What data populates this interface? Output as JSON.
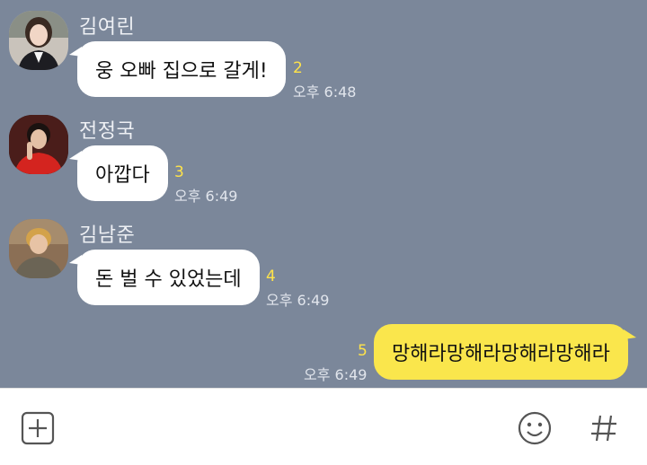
{
  "messages": [
    {
      "sender": "김여린",
      "text": "웅 오빠 집으로 갈게!",
      "unread": "2",
      "time": "오후 6:48",
      "avatar": "profile-photo"
    },
    {
      "sender": "전정국",
      "text": "아깝다",
      "unread": "3",
      "time": "오후 6:49",
      "avatar": "profile-photo"
    },
    {
      "sender": "김남준",
      "text": "돈 벌 수 있었는데",
      "unread": "4",
      "time": "오후 6:49",
      "avatar": "profile-photo"
    }
  ],
  "my_message": {
    "text": "망해라망해라망해라망해라",
    "unread": "5",
    "time": "오후 6:49"
  },
  "input_bar": {
    "left_icon": "plus-icon",
    "emoji_icon": "emoticon-icon",
    "hash_icon": "hash-icon"
  },
  "colors": {
    "chat_background": "#7b879a",
    "incoming_bubble": "#ffffff",
    "outgoing_bubble": "#fae64c",
    "unread_count": "#ffe34a"
  }
}
